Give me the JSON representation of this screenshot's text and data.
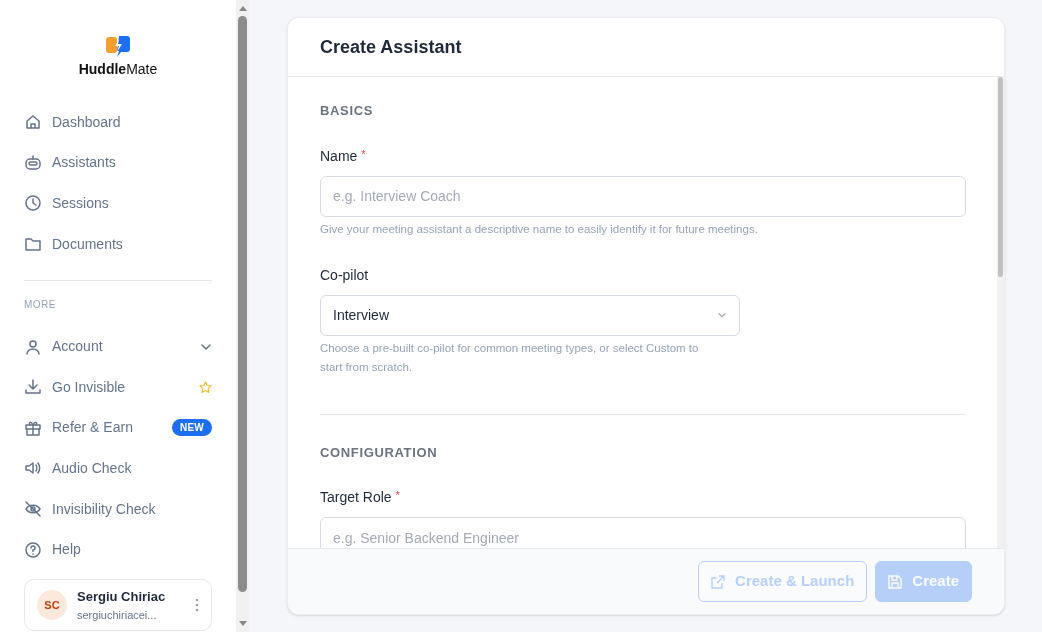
{
  "sidebar": {
    "brand": {
      "bold": "Huddle",
      "light": "Mate"
    },
    "items": [
      {
        "label": "Dashboard"
      },
      {
        "label": "Assistants"
      },
      {
        "label": "Sessions"
      },
      {
        "label": "Documents"
      }
    ],
    "more_heading": "MORE",
    "more_items": [
      {
        "label": "Account",
        "kind": "expandable",
        "expanded": false
      },
      {
        "label": "Go Invisible",
        "kind": "starred"
      },
      {
        "label": "Refer & Earn",
        "kind": "badge",
        "badge": "NEW"
      },
      {
        "label": "Audio Check"
      },
      {
        "label": "Invisibility Check"
      },
      {
        "label": "Help"
      }
    ],
    "user": {
      "initials": "SC",
      "name": "Sergiu Chiriac",
      "email": "sergiuchiriacei..."
    }
  },
  "card": {
    "title": "Create Assistant",
    "sections": [
      {
        "heading": "BASICS",
        "fields": [
          {
            "kind": "text",
            "label": "Name",
            "required_mark": "*",
            "placeholder": "e.g. Interview Coach",
            "help": "Give your meeting assistant a descriptive name to easily identify it for future meetings."
          },
          {
            "kind": "select",
            "label": "Co-pilot",
            "value": "Interview",
            "help": "Choose a pre-built co-pilot for common meeting types, or select Custom to start from scratch."
          }
        ]
      },
      {
        "heading": "CONFIGURATION",
        "fields": [
          {
            "kind": "text",
            "label": "Target Role",
            "required_mark": "*",
            "placeholder": "e.g. Senior Backend Engineer"
          }
        ]
      }
    ],
    "buttons": [
      {
        "label": "Create & Launch",
        "kind": "outline",
        "disabled": true
      },
      {
        "label": "Create",
        "kind": "primary",
        "disabled": true
      }
    ]
  }
}
